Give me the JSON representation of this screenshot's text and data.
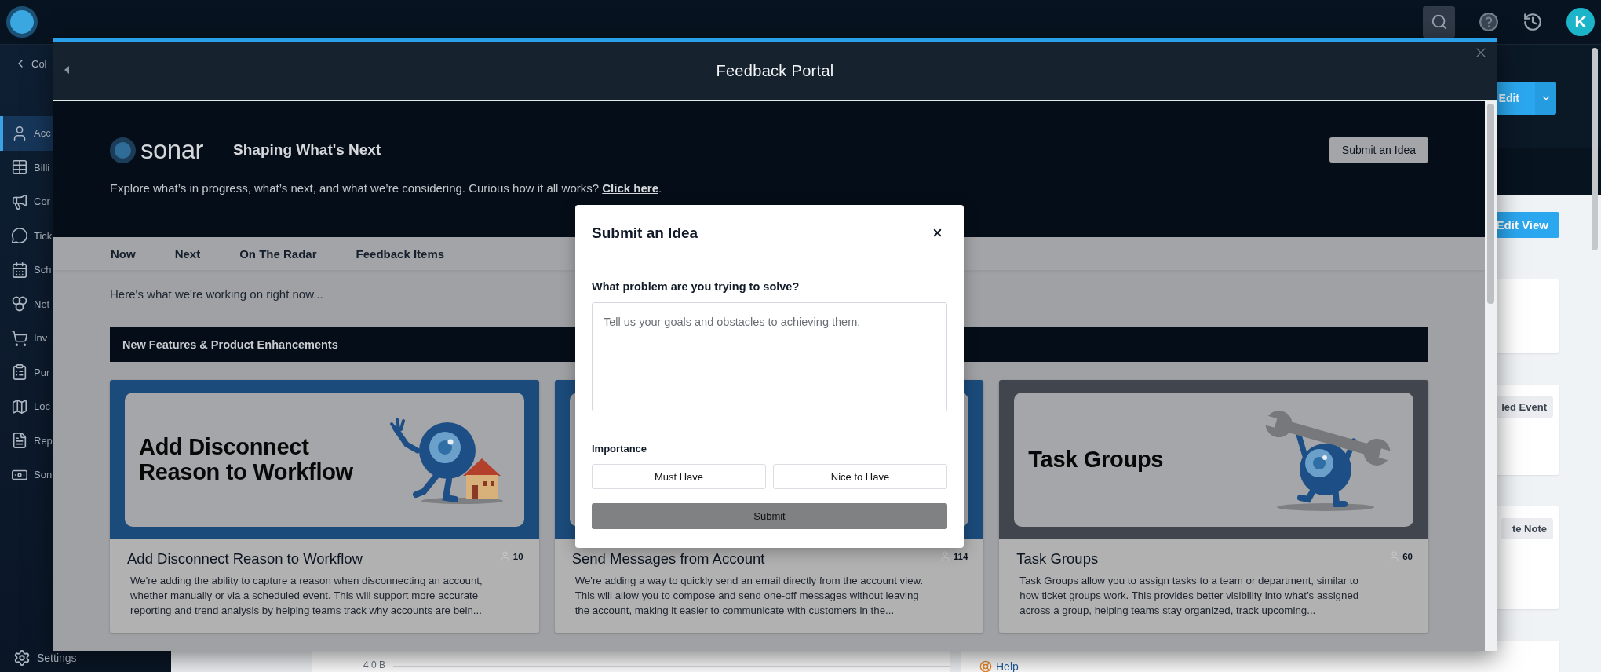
{
  "top_bar": {
    "avatar_initial": "K"
  },
  "sidebar": {
    "collapse_label": "Col",
    "items": [
      {
        "label": "Acc",
        "selected": true
      },
      {
        "label": "Billi",
        "selected": false
      },
      {
        "label": "Cor",
        "selected": false
      },
      {
        "label": "Tick",
        "selected": false
      },
      {
        "label": "Sch",
        "selected": false
      },
      {
        "label": "Net",
        "selected": false
      },
      {
        "label": "Inv",
        "selected": false
      },
      {
        "label": "Pur",
        "selected": false
      },
      {
        "label": "Loc",
        "selected": false
      },
      {
        "label": "Rep",
        "selected": false
      },
      {
        "label": "Son",
        "selected": false
      }
    ],
    "settings_label": "Settings"
  },
  "page": {
    "edit_button": "Edit",
    "edit_view_button": "Edit View",
    "tag_chips": [
      "led Event",
      "te Note"
    ],
    "chart_axis_label": "4.0 B",
    "help_link": "Help"
  },
  "portal": {
    "title": "Feedback Portal",
    "hero": {
      "logo_text": "sonar",
      "title": "Shaping What's Next",
      "intro": "Explore what’s in progress, what’s next, and what we’re considering. Curious how it all works?",
      "intro_link": "Click here",
      "intro_end": ".",
      "submit_button": "Submit an Idea"
    },
    "tabs": [
      "Now",
      "Next",
      "On The Radar",
      "Feedback Items"
    ],
    "lead": "Here's what we're working on right now...",
    "section_title": "New Features & Product Enhancements",
    "cards": [
      {
        "kind": "house",
        "color": "#1b4b7b",
        "banner_lines": [
          "Add Disconnect",
          "Reason to Workflow"
        ],
        "title": "Add Disconnect Reason to Workflow",
        "votes": "10",
        "description_lines": [
          "We're adding the ability to capture a reason when disconnecting an account,",
          "whether manually or via a scheduled event. This will support more accurate",
          "reporting and trend analysis by helping teams track why accounts are bein..."
        ]
      },
      {
        "kind": "plain",
        "color": "#1b4b7b",
        "title": "Send Messages from Account",
        "votes": "114",
        "description_lines": [
          "We're adding a way to quickly send an email directly from the account view.",
          "This will allow you to compose and send one-off messages without leaving",
          "the account, making it easier to communicate with customers in the..."
        ]
      },
      {
        "kind": "wrench",
        "color": "#40454e",
        "banner_lines": [
          "Task Groups"
        ],
        "title": "Task Groups",
        "votes": "60",
        "description_lines": [
          "Task Groups allow you to assign tasks to a team or department, similar to",
          "how ticket groups work. This provides better visibility into what’s assigned",
          "across a group, helping teams stay organized, track upcoming..."
        ]
      }
    ]
  },
  "dialog": {
    "title": "Submit an Idea",
    "question": "What problem are you trying to solve?",
    "placeholder": "Tell us your goals and obstacles to achieving them.",
    "importance_label": "Importance",
    "importance_options": [
      {
        "label": "Must Have",
        "selected": false
      },
      {
        "label": "Nice to Have",
        "selected": false
      }
    ],
    "submit": "Submit",
    "submit_disabled": true
  }
}
